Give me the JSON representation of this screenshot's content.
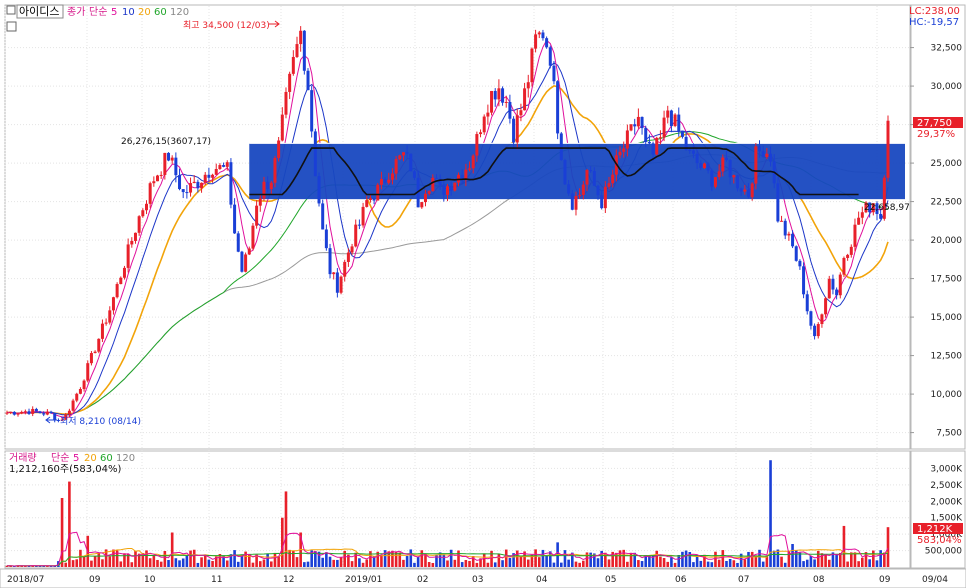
{
  "header": {
    "stock_name": "아이디스",
    "indicator_price": "종가",
    "indicator_method": "단순",
    "ma_periods": [
      "5",
      "10",
      "20",
      "60",
      "120"
    ],
    "lc_label": "LC:238,00",
    "hc_label": "HC:-19,57"
  },
  "volume_header": {
    "title": "거래량",
    "method": "단순",
    "ma_periods": [
      "5",
      "20",
      "60",
      "120"
    ],
    "volume_readout": "1,212,160주(583,04%)"
  },
  "annotations": {
    "high": "최고 34,500 (12/03)",
    "low": "최저 8,210 (08/14)",
    "box_top_label": "26,276,15(3607,17)",
    "box_bottom_label": "22,658,97"
  },
  "badges": {
    "price_last": "27,750",
    "price_pct": "29,37%",
    "volume_last": "1,212K",
    "volume_pct": "583,04%"
  },
  "colors": {
    "up": "#e8202a",
    "down": "#1a3fd6",
    "ma5": "#e0109c",
    "ma10": "#1c36c8",
    "ma20": "#f2a40a",
    "ma60": "#21a62b",
    "ma120": "#9a9a9a",
    "box": "#1848c0",
    "box_line": "#111111"
  },
  "chart_data": {
    "type": "candlestick",
    "y_axis_ticks": [
      "32,500",
      "30,000",
      "27,500",
      "25,000",
      "22,500",
      "20,000",
      "17,500",
      "15,000",
      "12,500",
      "10,000",
      "7,500"
    ],
    "volume_axis_ticks": [
      "3,000K",
      "2,500K",
      "2,000K",
      "1,500K",
      "1,000K",
      "500,000"
    ],
    "x_axis_ticks": [
      "2018/07",
      "09",
      "10",
      "11",
      "12",
      "2019/01",
      "02",
      "03",
      "04",
      "05",
      "06",
      "07",
      "08",
      "09",
      "09/04"
    ],
    "ylim": [
      6500,
      35200
    ],
    "volume_ylim": [
      0,
      3500
    ],
    "highlight_zone": [
      22658.97,
      26276.15
    ],
    "price_path": [
      [
        0,
        8800
      ],
      [
        6,
        8900
      ],
      [
        12,
        8700
      ],
      [
        14,
        8300
      ],
      [
        16,
        8600
      ],
      [
        20,
        10500
      ],
      [
        24,
        13000
      ],
      [
        28,
        15500
      ],
      [
        32,
        18500
      ],
      [
        36,
        21500
      ],
      [
        40,
        24000
      ],
      [
        44,
        25500
      ],
      [
        48,
        23000
      ],
      [
        52,
        23800
      ],
      [
        56,
        24800
      ],
      [
        60,
        24500
      ],
      [
        62,
        20500
      ],
      [
        64,
        18000
      ],
      [
        66,
        19500
      ],
      [
        68,
        22500
      ],
      [
        70,
        23500
      ],
      [
        72,
        24000
      ],
      [
        74,
        26000
      ],
      [
        76,
        29000
      ],
      [
        78,
        31500
      ],
      [
        80,
        33500
      ],
      [
        82,
        30000
      ],
      [
        84,
        24500
      ],
      [
        86,
        20500
      ],
      [
        88,
        18000
      ],
      [
        90,
        17000
      ],
      [
        92,
        18500
      ],
      [
        94,
        20000
      ],
      [
        96,
        21000
      ],
      [
        98,
        22500
      ],
      [
        100,
        23000
      ],
      [
        102,
        23500
      ],
      [
        104,
        24500
      ],
      [
        106,
        25000
      ],
      [
        108,
        25500
      ],
      [
        110,
        24800
      ],
      [
        112,
        22500
      ],
      [
        114,
        23500
      ],
      [
        116,
        24000
      ],
      [
        118,
        23200
      ],
      [
        120,
        23500
      ],
      [
        122,
        24000
      ],
      [
        124,
        24500
      ],
      [
        126,
        25000
      ],
      [
        128,
        26500
      ],
      [
        130,
        28500
      ],
      [
        132,
        29500
      ],
      [
        134,
        30000
      ],
      [
        136,
        29000
      ],
      [
        138,
        27000
      ],
      [
        140,
        28500
      ],
      [
        142,
        30500
      ],
      [
        144,
        33000
      ],
      [
        146,
        33500
      ],
      [
        148,
        32000
      ],
      [
        150,
        27500
      ],
      [
        152,
        24000
      ],
      [
        154,
        22500
      ],
      [
        156,
        23000
      ],
      [
        158,
        24500
      ],
      [
        160,
        23500
      ],
      [
        162,
        22500
      ],
      [
        164,
        23500
      ],
      [
        166,
        25000
      ],
      [
        168,
        26000
      ],
      [
        170,
        27000
      ],
      [
        172,
        28000
      ],
      [
        174,
        26000
      ],
      [
        176,
        25500
      ],
      [
        178,
        26500
      ],
      [
        180,
        28500
      ],
      [
        182,
        27500
      ],
      [
        184,
        26500
      ],
      [
        186,
        25500
      ],
      [
        188,
        25000
      ],
      [
        190,
        24500
      ],
      [
        192,
        24000
      ],
      [
        194,
        24500
      ],
      [
        196,
        25000
      ],
      [
        198,
        24000
      ],
      [
        200,
        23500
      ],
      [
        202,
        23000
      ],
      [
        204,
        25500
      ],
      [
        206,
        26000
      ],
      [
        208,
        25500
      ],
      [
        210,
        21500
      ],
      [
        212,
        20500
      ],
      [
        214,
        19500
      ],
      [
        216,
        18000
      ],
      [
        218,
        15500
      ],
      [
        220,
        13500
      ],
      [
        222,
        15500
      ],
      [
        224,
        17500
      ],
      [
        226,
        16500
      ],
      [
        228,
        19000
      ],
      [
        230,
        20000
      ],
      [
        232,
        21500
      ],
      [
        234,
        22000
      ],
      [
        236,
        22500
      ],
      [
        238,
        21500
      ],
      [
        240,
        27750
      ]
    ],
    "volume_spikes": [
      [
        15,
        2100
      ],
      [
        17,
        2600
      ],
      [
        22,
        950
      ],
      [
        45,
        1050
      ],
      [
        75,
        1500
      ],
      [
        76,
        2300
      ],
      [
        80,
        1050
      ],
      [
        150,
        750
      ],
      [
        208,
        3250
      ],
      [
        214,
        700
      ],
      [
        228,
        1250
      ],
      [
        240,
        1212
      ]
    ]
  }
}
